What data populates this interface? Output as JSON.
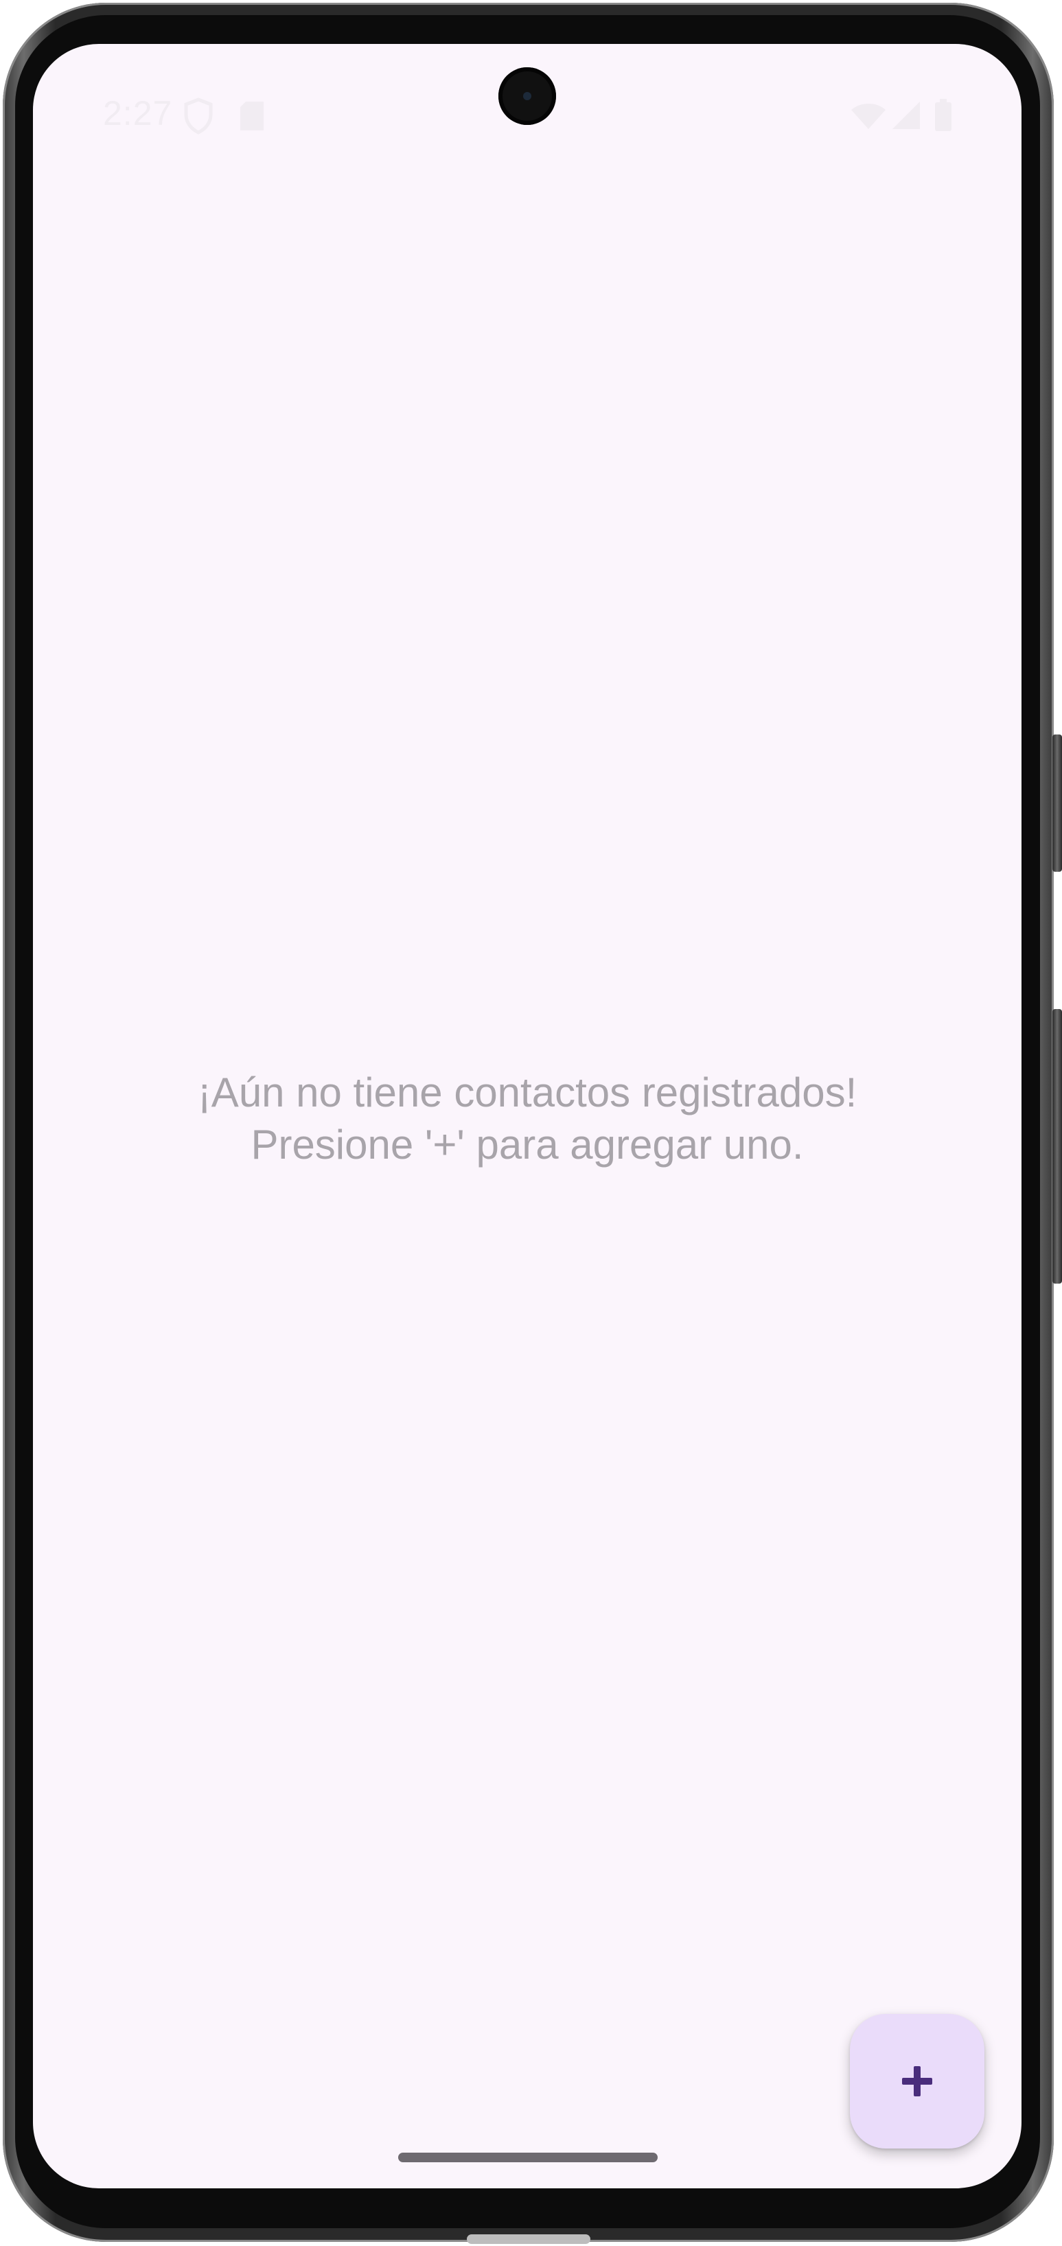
{
  "status_bar": {
    "time": "2:27",
    "icons": [
      "shield-icon",
      "sdcard-icon",
      "wifi-icon",
      "signal-icon",
      "battery-icon"
    ]
  },
  "main": {
    "empty_state": {
      "line1": "¡Aún no tiene contactos registrados!",
      "line2": "Presione '+' para agregar uno."
    }
  },
  "fab": {
    "icon": "plus-icon",
    "color": "#eadcfa",
    "icon_color": "#4a2d7c"
  },
  "colors": {
    "background": "#fbf5fc",
    "empty_text": "#a8a4aa"
  }
}
